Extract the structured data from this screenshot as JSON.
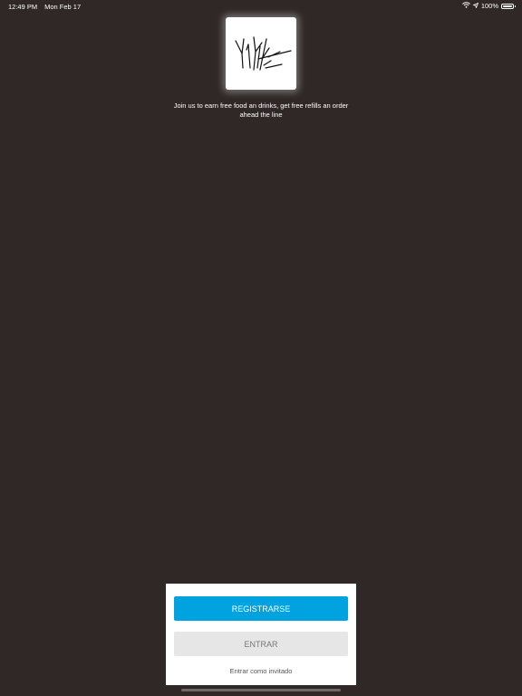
{
  "status_bar": {
    "time": "12:49 PM",
    "date": "Mon Feb 17",
    "battery_text": "100%",
    "battery_level": 1.0,
    "icons": [
      "wifi-icon",
      "location-arrow-icon",
      "battery-icon"
    ]
  },
  "logo": {
    "icon": "tree-branches-logo"
  },
  "tagline": "Join us to earn free food an drinks, get free refills an order ahead the line",
  "auth": {
    "register_label": "REGISTRARSE",
    "login_label": "ENTRAR",
    "guest_label": "Entrar como invitado"
  },
  "colors": {
    "background": "#2f2826",
    "primary_button": "#00a3e0",
    "secondary_button": "#e6e6e6",
    "panel": "#ffffff"
  }
}
